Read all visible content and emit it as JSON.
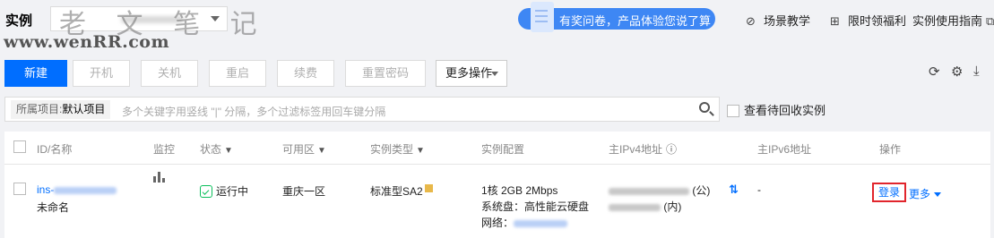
{
  "header": {
    "title": "实例",
    "watermark_cn": "老 文 笔 记",
    "watermark_url": "www.wenRR.com",
    "survey_label": "有奖问卷，产品体验您说了算",
    "links": [
      "场景教学",
      "限时领福利",
      "实例使用指南"
    ]
  },
  "toolbar": {
    "new": "新建",
    "start": "开机",
    "stop": "关机",
    "restart": "重启",
    "renew": "续费",
    "reset_password": "重置密码",
    "more_actions": "更多操作"
  },
  "search": {
    "tag_key": "所属项目:",
    "tag_value": "默认项目",
    "placeholder": "多个关键字用竖线 \"|\" 分隔，多个过滤标签用回车键分隔",
    "recycle_label": "查看待回收实例"
  },
  "table": {
    "columns": [
      "ID/名称",
      "监控",
      "状态",
      "可用区",
      "实例类型",
      "实例配置",
      "主IPv4地址",
      "主IPv6地址",
      "操作"
    ],
    "rows": [
      {
        "id_prefix": "ins-",
        "name": "未命名",
        "status": "运行中",
        "zone": "重庆一区",
        "type": "标准型SA2",
        "config_line1": "1核 2GB 2Mbps",
        "config_line2": "系统盘：高性能云硬盘",
        "config_line3_label": "网络：",
        "ipv4_public_suffix": "(公)",
        "ipv4_private_suffix": "(内)",
        "ipv6": "-",
        "login": "登录",
        "more": "更多"
      }
    ]
  },
  "colors": {
    "primary": "#006eff",
    "running": "#0abf5b",
    "highlight": "#e1252c"
  }
}
